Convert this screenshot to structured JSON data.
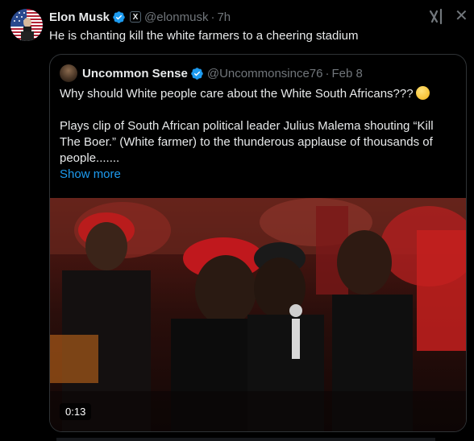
{
  "post": {
    "author_name": "Elon Musk",
    "author_handle": "@elonmusk",
    "separator": "·",
    "time": "7h",
    "affiliate_badge": "X",
    "text": "He is chanting kill the white farmers to a cheering stadium",
    "close_symbol": "✕"
  },
  "quote": {
    "author_name": "Uncommon Sense",
    "author_handle": "@Uncommonsince76",
    "separator": "·",
    "time": "Feb 8",
    "line1": "Why should White people care about the White South Africans???",
    "line1_emoji": "thinking-face-emoji",
    "line2": "Plays clip of South African political leader Julius Malema shouting “Kill",
    "line3": "The Boer.” (White farmer) to the thunderous applause of thousands of",
    "line4": "people.......",
    "show_more": "Show more",
    "video_duration": "0:13"
  },
  "colors": {
    "background": "#000000",
    "text_primary": "#e7e9ea",
    "text_secondary": "#71767b",
    "link_blue": "#1d9bf0",
    "verified_blue": "#1d9bf0",
    "border": "#2f3336"
  }
}
